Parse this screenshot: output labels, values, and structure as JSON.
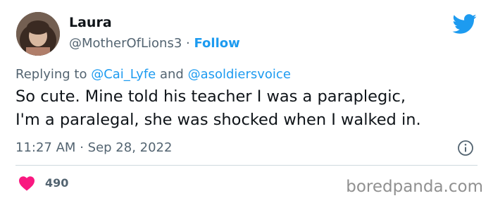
{
  "tweet": {
    "author_name": "Laura",
    "handle": "@MotherOfLions3",
    "separator": "·",
    "follow_label": "Follow",
    "reply": {
      "prefix": "Replying to ",
      "mention_1": "@Cai_Lyfe",
      "conjunction": " and ",
      "mention_2": "@asoldiersvoice"
    },
    "text_lines": [
      "So cute. Mine told his teacher I was a paraplegic,",
      "I'm a paralegal, she was shocked when I walked in."
    ],
    "time": "11:27 AM",
    "date_separator": "·",
    "date": "Sep 28, 2022",
    "likes": "490"
  },
  "watermark": "boredpanda.com",
  "colors": {
    "accent": "#1d9bf0",
    "secondary_text": "#536471",
    "heart": "#f91880",
    "divider": "#cfd9de"
  },
  "icons": {
    "brand": "twitter-bird-icon",
    "info": "info-icon",
    "like": "heart-icon"
  }
}
